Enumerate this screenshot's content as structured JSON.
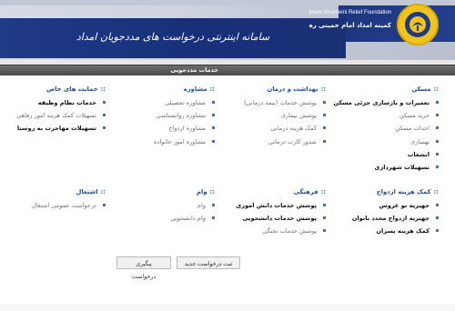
{
  "header": {
    "system_title": "سامانه اینترنتی درخواست های مددجویان امداد",
    "org_name_en": "Imam Khomeini Relief Foundation",
    "org_name_fa": "کمیته امداد امام خمینی ره"
  },
  "panel": {
    "title": "خدمات مددجویی"
  },
  "sections": {
    "housing": {
      "title": "مسکن",
      "items": [
        "تعمیرات و بازسازی جزئی مسکن",
        "خرید مسکن",
        "احداث مسکن",
        "بهسازی",
        "انشعاب",
        "تسهیلات شهرداری"
      ]
    },
    "health": {
      "title": "بهداشت و درمان",
      "items": [
        "پوشش خدمات (بیمه درمانی)",
        "پوشش بیماری",
        "کمک هزینه درمانی",
        "صدور کارت درمانی"
      ]
    },
    "counseling": {
      "title": "مشاوره",
      "items": [
        "مشاوره تحصیلی",
        "مشاوره روانشناسی",
        "مشاوره ازدواج",
        "مشاوره امور خانواده"
      ]
    },
    "special_support": {
      "title": "حمایت های خاص",
      "items": [
        "خدمات نظام وظیفه",
        "تسهیلات کمک هزینه امور رفاهی",
        "تسهیلات مهاجرت به روستا"
      ]
    },
    "marriage": {
      "title": "کمک هزینه ازدواج",
      "items": [
        "جهیزیه نو عروس",
        "جهیزیه ازدواج مجدد بانوان",
        "کمک هزینه پسران"
      ]
    },
    "culture": {
      "title": "فرهنگی",
      "items": [
        "پوشش خدمات دانش اموزی",
        "پوشش خدمات دانشجویی",
        "پوشش خدمات نخبگی"
      ]
    },
    "loan": {
      "title": "وام",
      "items": [
        "وام",
        "وام دانشجویی"
      ]
    },
    "employment": {
      "title": "اشتغال",
      "items": [
        "درخواست عمومی اشتغال"
      ]
    }
  },
  "buttons": {
    "new_request": "ثبت درخواست جدید",
    "track_request": "پیگیری درخواست"
  },
  "colors": {
    "accent": "#1f4f9c",
    "navy": "#1f3a86",
    "header_bar": "#555555"
  }
}
